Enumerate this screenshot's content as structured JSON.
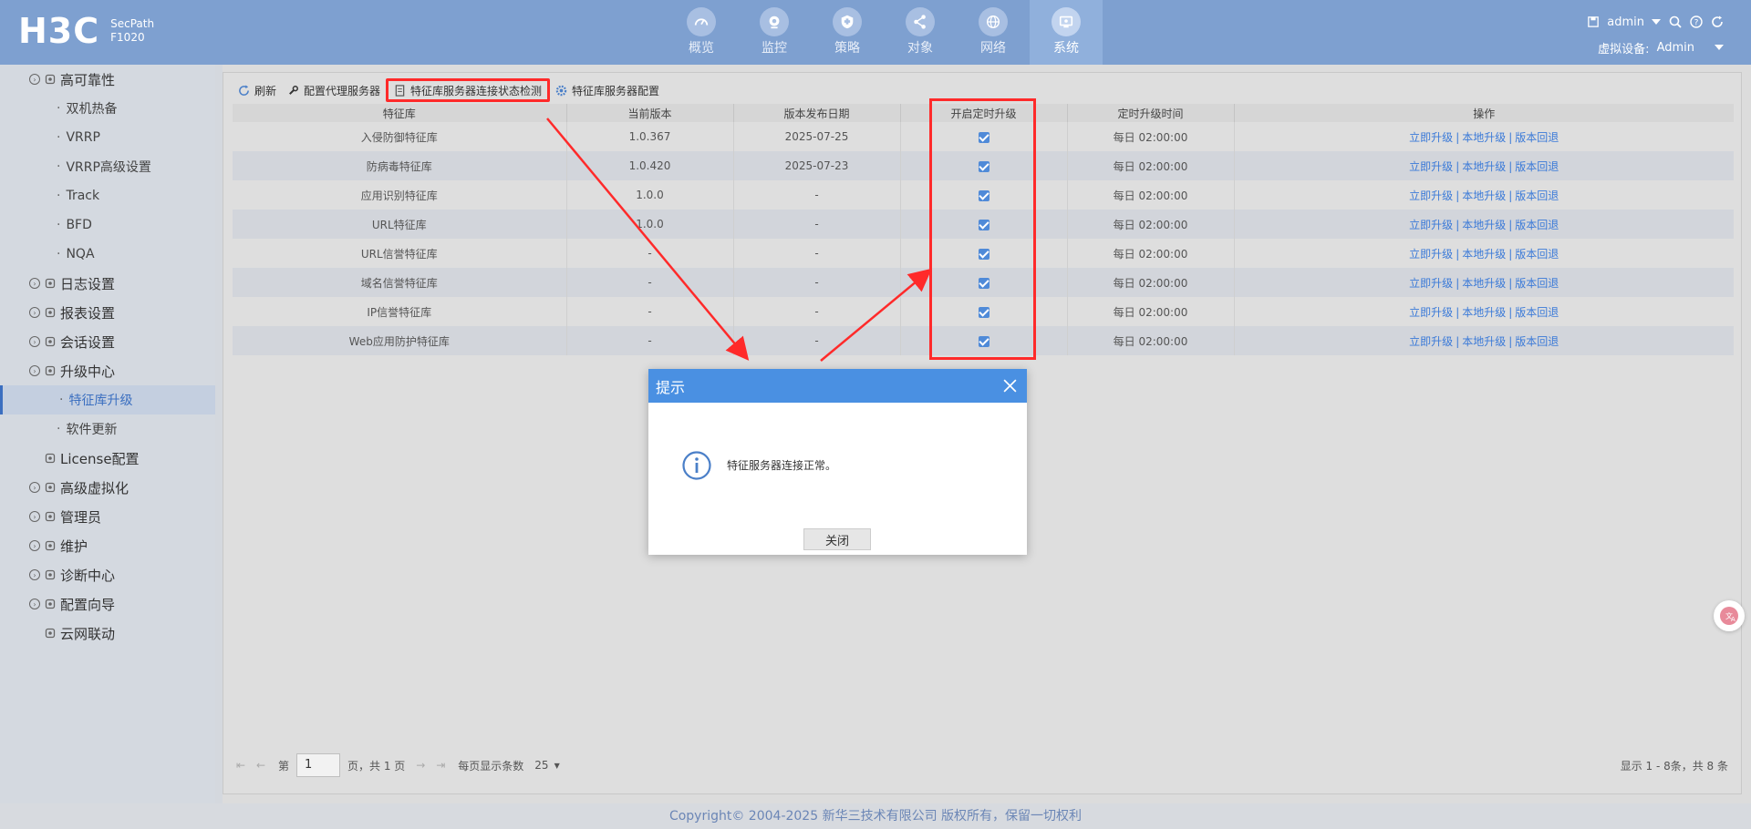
{
  "header": {
    "logo": "H3C",
    "product_line1": "SecPath",
    "product_line2": "F1020",
    "nav": [
      {
        "label": "概览",
        "icon": "gauge-icon"
      },
      {
        "label": "监控",
        "icon": "camera-icon"
      },
      {
        "label": "策略",
        "icon": "shield-icon"
      },
      {
        "label": "对象",
        "icon": "share-icon"
      },
      {
        "label": "网络",
        "icon": "globe-icon"
      },
      {
        "label": "系统",
        "icon": "monitor-icon",
        "active": true
      }
    ],
    "user": "admin",
    "virtual_device_label": "虚拟设备:",
    "virtual_device": "Admin"
  },
  "sidebar": {
    "items": [
      {
        "label": "高可靠性",
        "level": 1
      },
      {
        "label": "双机热备",
        "level": 2
      },
      {
        "label": "VRRP",
        "level": 2
      },
      {
        "label": "VRRP高级设置",
        "level": 2
      },
      {
        "label": "Track",
        "level": 2
      },
      {
        "label": "BFD",
        "level": 2
      },
      {
        "label": "NQA",
        "level": 2
      },
      {
        "label": "日志设置",
        "level": 1
      },
      {
        "label": "报表设置",
        "level": 1
      },
      {
        "label": "会话设置",
        "level": 1
      },
      {
        "label": "升级中心",
        "level": 1
      },
      {
        "label": "特征库升级",
        "level": 2,
        "active": true
      },
      {
        "label": "软件更新",
        "level": 2
      },
      {
        "label": "License配置",
        "level": 1
      },
      {
        "label": "高级虚拟化",
        "level": 1
      },
      {
        "label": "管理员",
        "level": 1
      },
      {
        "label": "维护",
        "level": 1
      },
      {
        "label": "诊断中心",
        "level": 1
      },
      {
        "label": "配置向导",
        "level": 1
      },
      {
        "label": "云网联动",
        "level": 1
      }
    ]
  },
  "toolbar": {
    "refresh": "刷新",
    "proxy": "配置代理服务器",
    "check": "特征库服务器连接状态检测",
    "server_config": "特征库服务器配置"
  },
  "table": {
    "headers": [
      "特征库",
      "当前版本",
      "版本发布日期",
      "开启定时升级",
      "定时升级时间",
      "操作"
    ],
    "rows": [
      {
        "name": "入侵防御特征库",
        "version": "1.0.367",
        "date": "2025-07-25",
        "time": "每日 02:00:00"
      },
      {
        "name": "防病毒特征库",
        "version": "1.0.420",
        "date": "2025-07-23",
        "time": "每日 02:00:00"
      },
      {
        "name": "应用识别特征库",
        "version": "1.0.0",
        "date": "-",
        "time": "每日 02:00:00"
      },
      {
        "name": "URL特征库",
        "version": "1.0.0",
        "date": "-",
        "time": "每日 02:00:00"
      },
      {
        "name": "URL信誉特征库",
        "version": "-",
        "date": "-",
        "time": "每日 02:00:00"
      },
      {
        "name": "域名信誉特征库",
        "version": "-",
        "date": "-",
        "time": "每日 02:00:00"
      },
      {
        "name": "IP信誉特征库",
        "version": "-",
        "date": "-",
        "time": "每日 02:00:00"
      },
      {
        "name": "Web应用防护特征库",
        "version": "-",
        "date": "-",
        "time": "每日 02:00:00"
      }
    ],
    "ops": [
      "立即升级",
      "本地升级",
      "版本回退"
    ]
  },
  "pager": {
    "prefix": "第",
    "page": "1",
    "suffix": "页，共 1 页",
    "per_page_label": "每页显示条数",
    "per_page": "25",
    "info": "显示 1 - 8条，共 8 条"
  },
  "footer": "Copyright© 2004-2025 新华三技术有限公司 版权所有，保留一切权利",
  "dialog": {
    "title": "提示",
    "message": "特征服务器连接正常。",
    "close_label": "关闭"
  },
  "colors": {
    "header_bg": "#7ea0d0",
    "dialog_title_bg": "#4a90e2",
    "highlight": "#ff2a2a",
    "link": "#3b7ad8"
  }
}
